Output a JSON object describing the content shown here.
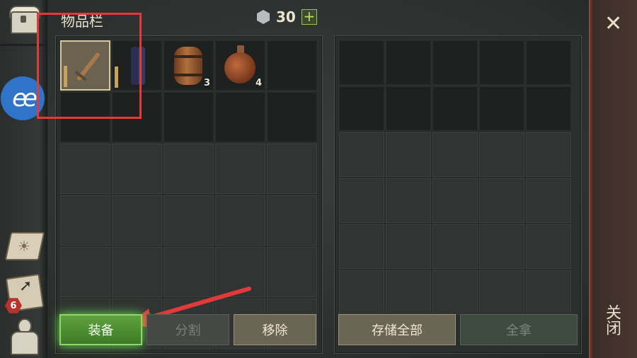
{
  "header": {
    "title": "物品栏",
    "currency_value": "30",
    "add_label": "+"
  },
  "inventory": {
    "items": [
      {
        "name": "sword",
        "count": "",
        "selected": true
      },
      {
        "name": "pants",
        "count": ""
      },
      {
        "name": "barrel",
        "count": "3"
      },
      {
        "name": "flask",
        "count": "4"
      }
    ]
  },
  "rail": {
    "ee_label": "ee",
    "map_badge": "6"
  },
  "buttons": {
    "equip": "装备",
    "split": "分割",
    "remove": "移除",
    "store_all": "存储全部",
    "take_all": "全拿"
  },
  "close": {
    "x_label": "✕",
    "label": "关闭"
  },
  "colors": {
    "highlight": "#e23a3a",
    "equip_green": "#5fa33e"
  }
}
